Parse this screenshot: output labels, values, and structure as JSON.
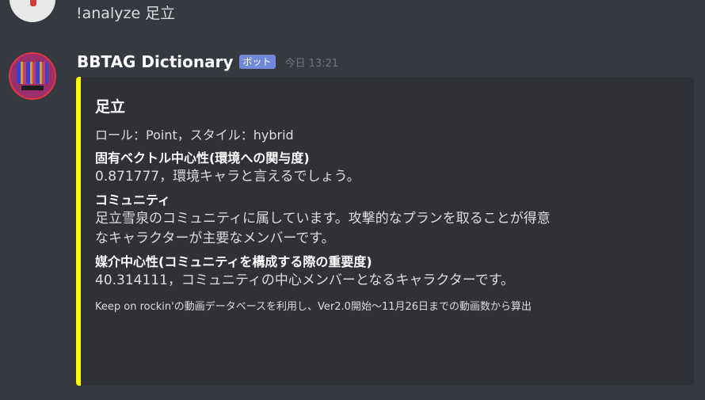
{
  "previous_message": {
    "text": "!analyze 足立"
  },
  "message": {
    "author": "BBTAG Dictionary",
    "badge": "ボット",
    "timestamp": "今日 13:21",
    "accent_color": "#ffff00",
    "embed": {
      "title": "足立",
      "description": "ロール：Point，スタイル：hybrid",
      "fields": [
        {
          "name": "固有ベクトル中心性(環境への関与度)",
          "value": "0.871777，環境キャラと言えるでしょう。"
        },
        {
          "name": "コミュニティ",
          "value_line1": "足立雪泉のコミュニティに属しています。攻撃的なプランを取ることが得意",
          "value_line2": "なキャラクターが主要なメンバーです。"
        },
        {
          "name": "媒介中心性(コミュニティを構成する際の重要度)",
          "value": "40.314111，コミュニティの中心メンバーとなるキャラクターです。"
        }
      ],
      "footer": "Keep on rockin'の動画データベースを利用し、Ver2.0開始～11月26日までの動画数から算出"
    }
  }
}
